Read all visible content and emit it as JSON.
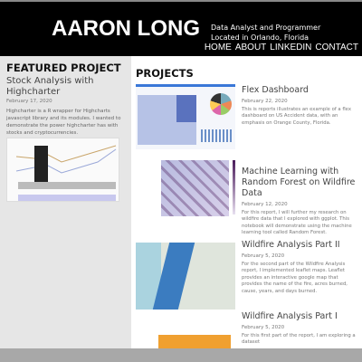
{
  "header": {
    "name": "AARON LONG",
    "tagline_1": "Data Analyst and Programmer",
    "tagline_2": "Located in Orlando, Florida",
    "nav": [
      "HOME",
      "ABOUT",
      "LINKEDIN",
      "CONTACT"
    ]
  },
  "featured": {
    "heading": "FEATURED PROJECT",
    "title": "Stock Analysis with Highcharter",
    "date": "February 17, 2020",
    "description": "Highcharter is a R wrapper for Highcharts javascript library and its modules. I wanted to demonstrate the power highcharter has with stocks and cryptocurrencies."
  },
  "projects": {
    "heading": "PROJECTS",
    "items": [
      {
        "title": "Flex Dashboard",
        "date": "February 22, 2020",
        "description": "This is reports illustrates an example of a flex dashboard on US Accident data, with an emphasis on Orange County, Florida."
      },
      {
        "title": "Machine Learning with Random Forest on Wildfire Data",
        "date": "February 12, 2020",
        "description": "For this report, I will further my research on wildfire data that I explored with ggplot. This notebook will demonstrate using the machine learning tool called Random Forest."
      },
      {
        "title": "Wildfire Analysis Part II",
        "date": "February 5, 2020",
        "description": "For the second part of the Wildfire Analysis report, I implemented leaflet maps. Leaflet provides an interactive google map that provides the name of the fire, acres burned, cause, years, and days burned."
      },
      {
        "title": "Wildfire Analysis Part I",
        "date": "February 5, 2020",
        "description": "For this first part of the report, I am exploring a dataset"
      }
    ]
  },
  "colors": {
    "header_bg": "#000000",
    "sidebar_bg": "#e6e6e6",
    "footer_bar": "#a8a8a8"
  }
}
